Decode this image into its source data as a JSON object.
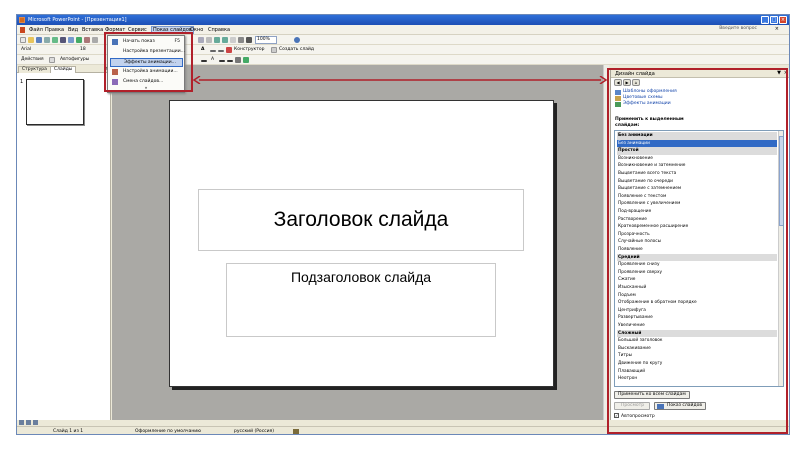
{
  "titlebar": {
    "title": "Microsoft PowerPoint - [Презентация1]"
  },
  "menubar": {
    "items": [
      "Файл",
      "Правка",
      "Вид",
      "Вставка",
      "Формат",
      "Сервис",
      "Показ слайдов",
      "Окно",
      "Справка"
    ],
    "help_box": "Введите вопрос",
    "close_glyph": "×"
  },
  "toolbar": {
    "zoom": "100%",
    "font_name": "Arial",
    "font_size": "18",
    "designer_label": "Конструктор",
    "new_slide_label": "Создать слайд",
    "actions_label": "Действия",
    "autoshapes_label": "Автофигуры"
  },
  "dropdown": {
    "items": [
      {
        "label": "Начать показ",
        "shortcut": "F5"
      },
      {
        "label": "Настройка презентации...",
        "shortcut": ""
      },
      {
        "label": "Эффекты анимации...",
        "shortcut": ""
      },
      {
        "label": "Настройка анимации...",
        "shortcut": ""
      },
      {
        "label": "Смена слайдов...",
        "shortcut": ""
      }
    ],
    "more_glyph": "»"
  },
  "left_pane": {
    "tabs": [
      "Структура",
      "Слайды"
    ],
    "close_glyph": "×",
    "slide_number": "1"
  },
  "slide": {
    "title_placeholder": "Заголовок слайда",
    "subtitle_placeholder": "Подзаголовок слайда"
  },
  "task_pane": {
    "title": "Дизайн слайда",
    "arrow_glyph": "▼",
    "close_glyph": "×",
    "links": [
      "Шаблоны оформления",
      "Цветовые схемы",
      "Эффекты анимации"
    ],
    "apply_label_line1": "Применить к выделенным",
    "apply_label_line2": "слайдам:",
    "list": [
      {
        "label": "Без анимации",
        "type": "cat"
      },
      {
        "label": "Без анимации",
        "type": "sel"
      },
      {
        "label": "Простой",
        "type": "cat"
      },
      {
        "label": "Возникновение",
        "type": "item"
      },
      {
        "label": "Возникновение и затемнение",
        "type": "item"
      },
      {
        "label": "Выцветание всего текста",
        "type": "item"
      },
      {
        "label": "Выцветание по очереди",
        "type": "item"
      },
      {
        "label": "Выцветание с затемнением",
        "type": "item"
      },
      {
        "label": "Появление с текстом",
        "type": "item"
      },
      {
        "label": "Проявление с увеличением",
        "type": "item"
      },
      {
        "label": "Под-вращение",
        "type": "item"
      },
      {
        "label": "Растворение",
        "type": "item"
      },
      {
        "label": "Кратковременное расширение",
        "type": "item"
      },
      {
        "label": "Прозрачность",
        "type": "item"
      },
      {
        "label": "Случайные полосы",
        "type": "item"
      },
      {
        "label": "Появление",
        "type": "item"
      },
      {
        "label": "Средний",
        "type": "cat"
      },
      {
        "label": "Проявление снизу",
        "type": "item"
      },
      {
        "label": "Проявление сверху",
        "type": "item"
      },
      {
        "label": "Сжатие",
        "type": "item"
      },
      {
        "label": "Изысканный",
        "type": "item"
      },
      {
        "label": "Подъем",
        "type": "item"
      },
      {
        "label": "Отображение в обратном порядке",
        "type": "item"
      },
      {
        "label": "Центрифуга",
        "type": "item"
      },
      {
        "label": "Развертывание",
        "type": "item"
      },
      {
        "label": "Увеличение",
        "type": "item"
      },
      {
        "label": "Сложный",
        "type": "cat"
      },
      {
        "label": "Большой заголовок",
        "type": "item"
      },
      {
        "label": "Выскакивание",
        "type": "item"
      },
      {
        "label": "Титры",
        "type": "item"
      },
      {
        "label": "Движение по кругу",
        "type": "item"
      },
      {
        "label": "Плавающий",
        "type": "item"
      },
      {
        "label": "Неотрон",
        "type": "item"
      }
    ],
    "apply_all_button": "Применить ко всем слайдам",
    "preview_button": "Просмотр",
    "slideshow_button": "Показ слайдов",
    "autopreview_label": "Автопросмотр",
    "autopreview_checked_glyph": "✓"
  },
  "statusbar": {
    "slide": "Слайд 1 из 1",
    "design": "Оформление по умолчанию",
    "language": "русский (Россия)"
  },
  "colors": {
    "highlight": "#b0202a",
    "selection": "#316ac5"
  }
}
